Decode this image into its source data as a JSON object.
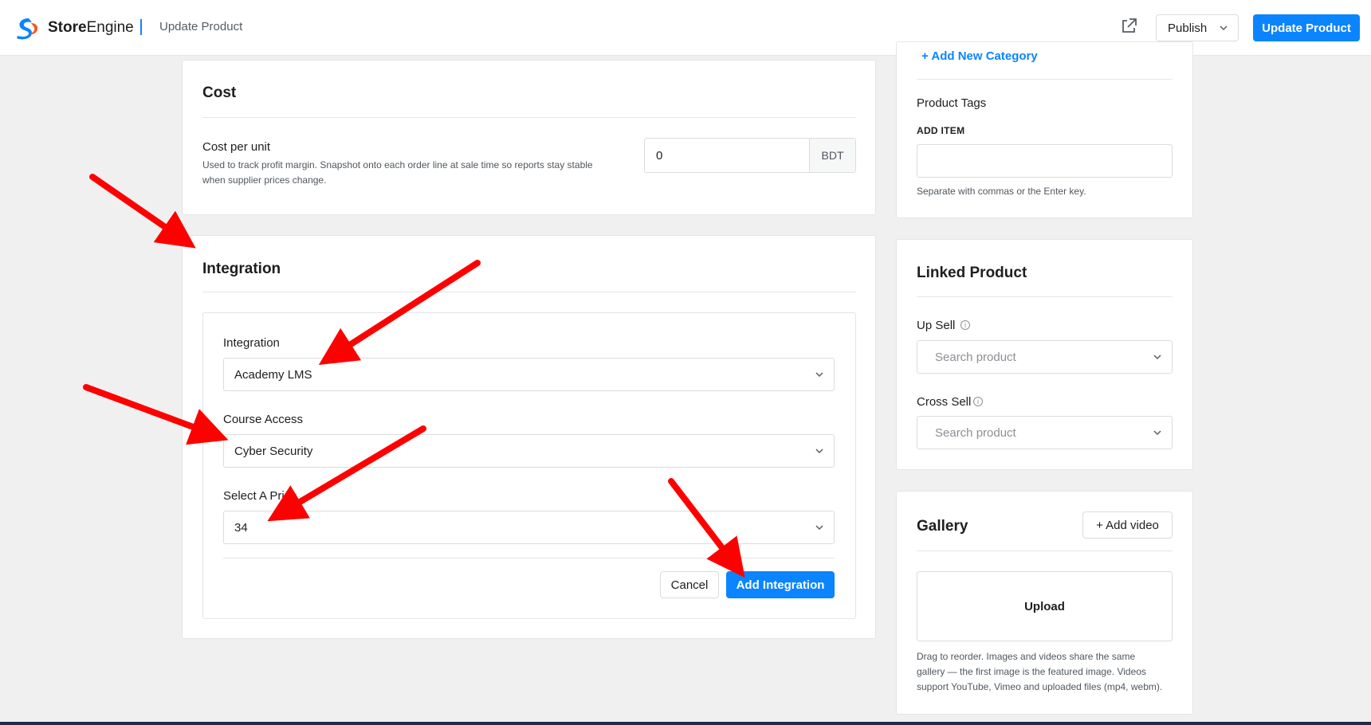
{
  "header": {
    "logo_bold": "Store",
    "logo_rest": "Engine",
    "page_title": "Update Product",
    "publish_label": "Publish",
    "update_label": "Update Product"
  },
  "cost": {
    "title": "Cost",
    "cost_label": "Cost per unit",
    "help_line1": "Used to track profit margin. Snapshot onto each order line at sale time so reports stay stable",
    "help_line2": "when supplier prices change.",
    "value": "0",
    "currency": "BDT"
  },
  "integration": {
    "title": "Integration",
    "integration_label": "Integration",
    "integration_value": "Academy LMS",
    "course_label": "Course Access",
    "course_value": "Cyber Security",
    "price_label": "Select A Price",
    "price_value": "34",
    "cancel_label": "Cancel",
    "add_label": "Add Integration"
  },
  "categories": {
    "add_new_label": "+ Add New Category"
  },
  "tags": {
    "title": "Product Tags",
    "add_item_label": "ADD ITEM",
    "help": "Separate with commas or the Enter key."
  },
  "linked": {
    "title": "Linked Product",
    "upsell_label": "Up Sell",
    "upsell_placeholder": "Search product",
    "crosssell_label": "Cross Sell",
    "crosssell_placeholder": "Search product"
  },
  "gallery": {
    "title": "Gallery",
    "add_video_label": "+ Add video",
    "upload_label": "Upload",
    "help_line1": "Drag to reorder. Images and videos share the same",
    "help_line2": "gallery — the first image is the featured image. Videos",
    "help_line3": "support YouTube, Vimeo and uploaded files (mp4, webm)."
  },
  "icons": {
    "external": "external-link-icon",
    "chevron": "chevron-down-icon",
    "info": "info-icon"
  },
  "colors": {
    "accent": "#0b84ff",
    "annotation_arrow": "#ff0000"
  }
}
